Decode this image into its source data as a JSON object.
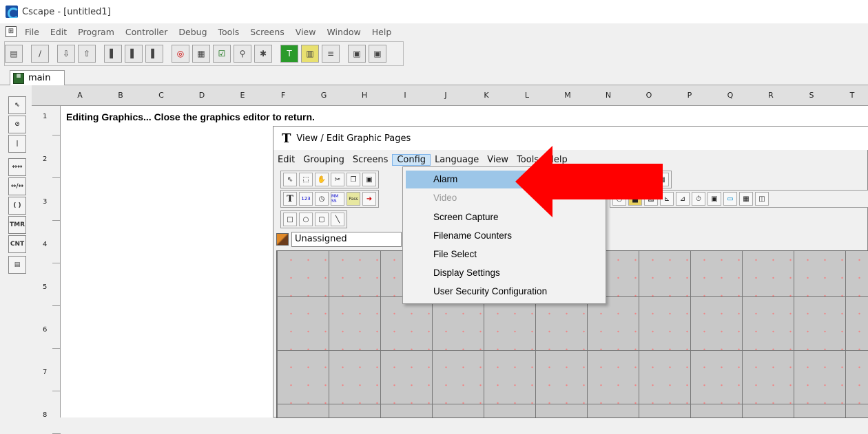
{
  "app": {
    "title": "Cscape - [untitled1]"
  },
  "menubar": [
    "File",
    "Edit",
    "Program",
    "Controller",
    "Debug",
    "Tools",
    "Screens",
    "View",
    "Window",
    "Help"
  ],
  "doc_tab": "main",
  "columns": [
    "A",
    "B",
    "C",
    "D",
    "E",
    "F",
    "G",
    "H",
    "I",
    "J",
    "K",
    "L",
    "M",
    "N",
    "O",
    "P",
    "Q",
    "R",
    "S",
    "T"
  ],
  "rows": [
    "1",
    "2",
    "3",
    "4",
    "5",
    "6",
    "7",
    "8"
  ],
  "left_tools": [
    "⇖",
    "⊘",
    "|",
    "↔↔",
    "↔/↔",
    "( )",
    "TMR",
    "CNT",
    "▤"
  ],
  "editing_message": "Editing Graphics... Close the graphics editor to return.",
  "graphics_window": {
    "icon": "T",
    "title": "View / Edit Graphic Pages",
    "menu": [
      "Edit",
      "Grouping",
      "Screens",
      "Config",
      "Language",
      "View",
      "Tools",
      "Help"
    ],
    "layer_value": "Unassigned"
  },
  "config_menu": {
    "items": [
      {
        "label": "Alarm",
        "state": "highlighted"
      },
      {
        "label": "Video",
        "state": "disabled"
      },
      {
        "label": "Screen Capture",
        "state": "normal"
      },
      {
        "label": "Filename Counters",
        "state": "normal"
      },
      {
        "label": "File Select",
        "state": "normal"
      },
      {
        "label": "Display Settings",
        "state": "normal"
      },
      {
        "label": "User  Security Configuration",
        "state": "normal"
      }
    ]
  },
  "colors": {
    "annotation_arrow": "#ff0000",
    "highlight": "#9cc6e8"
  },
  "icons": {
    "graphics_toolbar_row1": [
      "T",
      "123",
      "clock",
      "MM SS",
      "Pass",
      "arrows"
    ],
    "graphics_toolbar_row3": [
      "rect",
      "circle",
      "rounded-rect",
      "line"
    ]
  }
}
